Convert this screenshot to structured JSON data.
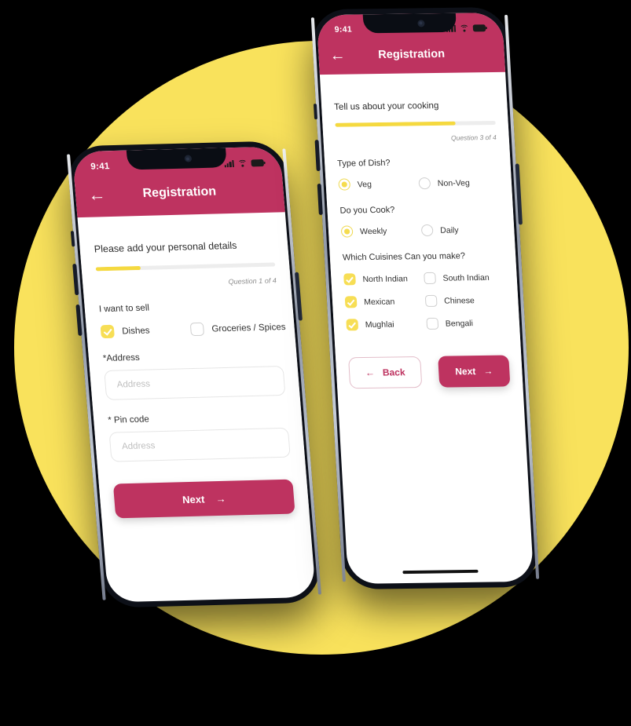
{
  "scene": {
    "background_color": "#000000",
    "accent_circle_color": "#F9E25C",
    "brand_color": "#BE3360",
    "highlight_color": "#F5D93F"
  },
  "phone_back": {
    "status_bar": {
      "time": "9:41",
      "icons": [
        "signal-icon",
        "wifi-icon",
        "battery-icon"
      ]
    },
    "nav": {
      "back_icon": "←",
      "title": "Registration"
    },
    "section_title": "Please add your personal details",
    "progress": {
      "percent": 25,
      "question_count": "Question 1 of 4"
    },
    "sell_label": "I want to sell",
    "sell_options": [
      {
        "label": "Dishes",
        "checked": true
      },
      {
        "label": "Groceries / Spices",
        "checked": false
      }
    ],
    "address_label": "*Address",
    "address_placeholder": "Address",
    "address_value": "",
    "pincode_label": "* Pin code",
    "pincode_placeholder": "Address",
    "pincode_value": "",
    "next_button": {
      "label": "Next",
      "arrow": "→"
    }
  },
  "phone_front": {
    "status_bar": {
      "time": "9:41",
      "icons": [
        "signal-icon",
        "wifi-icon",
        "battery-icon"
      ]
    },
    "nav": {
      "back_icon": "←",
      "title": "Registration"
    },
    "section_title": "Tell us about your cooking",
    "progress": {
      "percent": 75,
      "question_count": "Question 3 of 4"
    },
    "dish_label": "Type of Dish?",
    "dish_options": [
      {
        "label": "Veg",
        "selected": true
      },
      {
        "label": "Non-Veg",
        "selected": false
      }
    ],
    "cook_label": "Do you Cook?",
    "cook_options": [
      {
        "label": "Weekly",
        "selected": true
      },
      {
        "label": "Daily",
        "selected": false
      }
    ],
    "cuisine_label": "Which Cuisines Can you make?",
    "cuisine_options": [
      {
        "label": "North Indian",
        "checked": true
      },
      {
        "label": "South Indian",
        "checked": false
      },
      {
        "label": "Mexican",
        "checked": true
      },
      {
        "label": "Chinese",
        "checked": false
      },
      {
        "label": "Mughlai",
        "checked": true
      },
      {
        "label": "Bengali",
        "checked": false
      }
    ],
    "back_button": {
      "label": "Back",
      "arrow": "←"
    },
    "next_button": {
      "label": "Next",
      "arrow": "→"
    }
  }
}
